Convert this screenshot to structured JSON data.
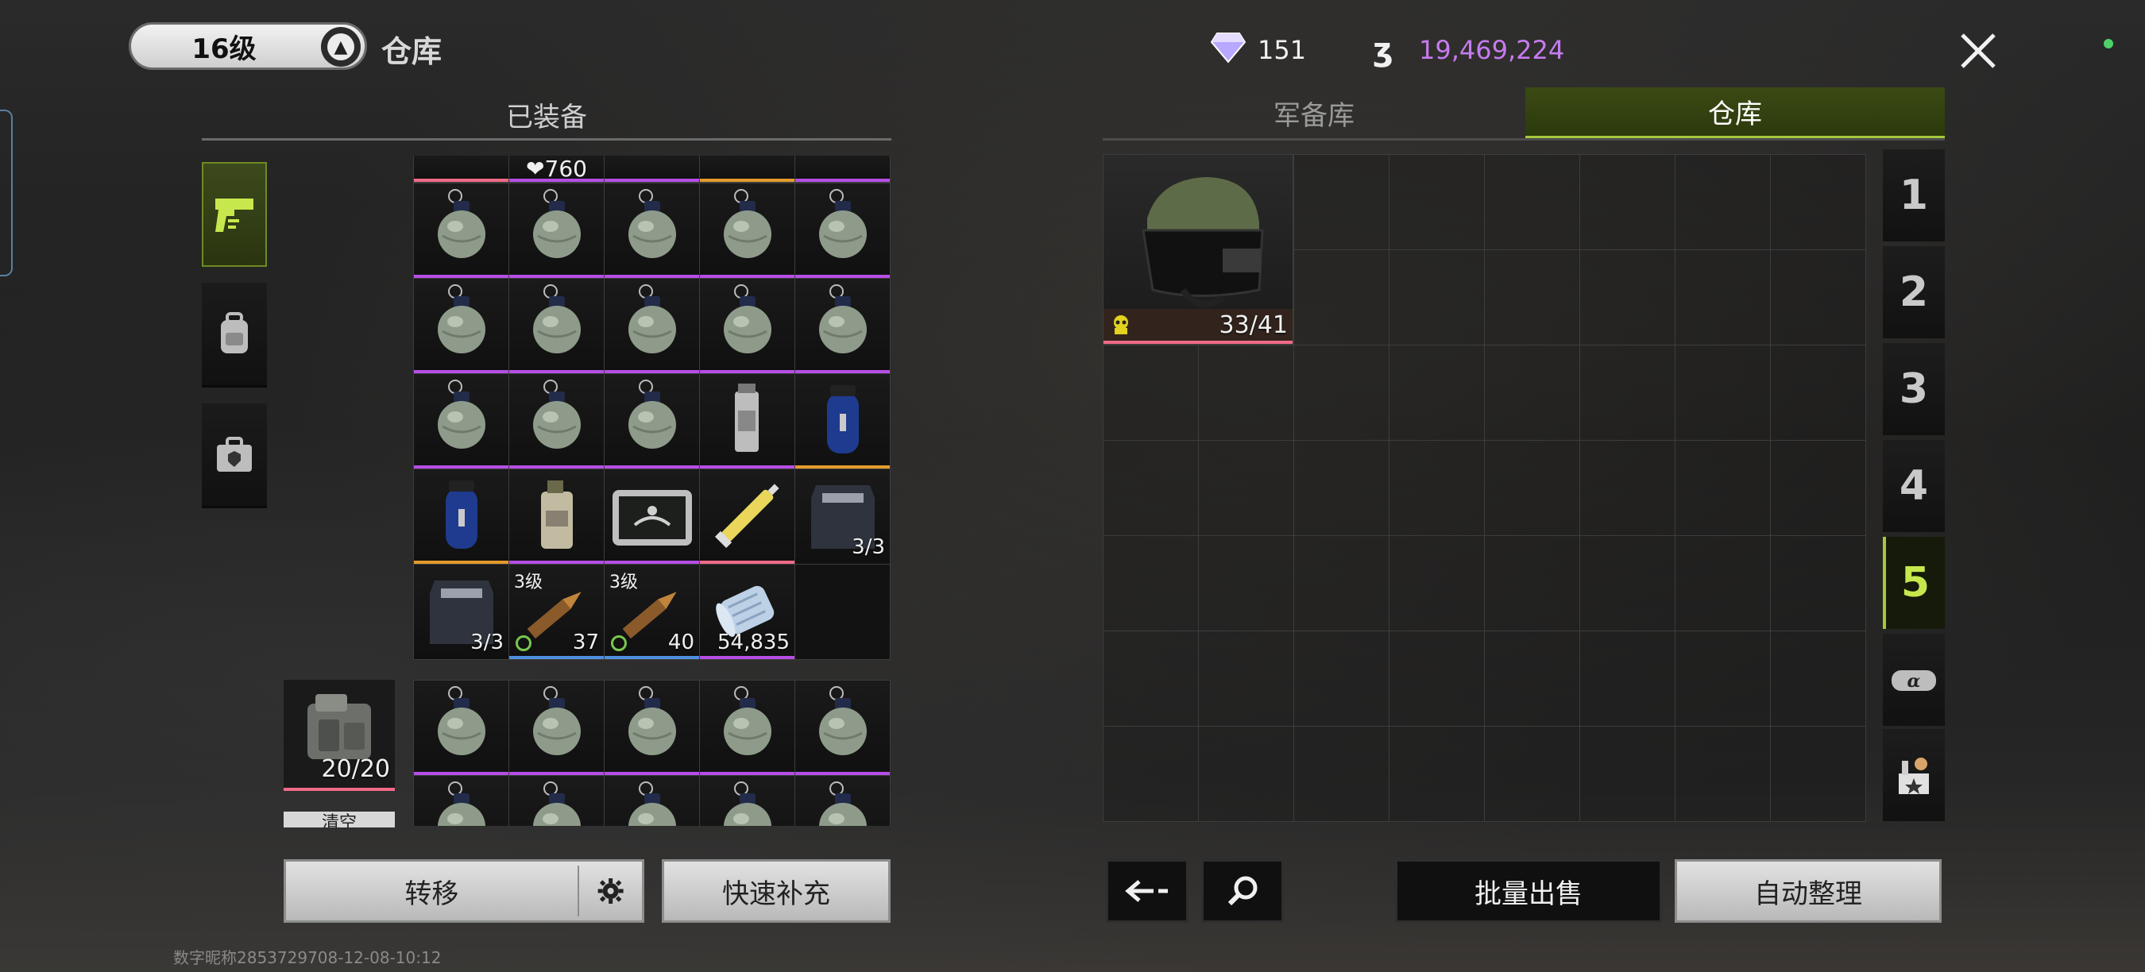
{
  "header": {
    "level": "16级",
    "title": "仓库",
    "diamonds": "151",
    "money": "19,469,224"
  },
  "colors": {
    "accent_green": "#a5c83a",
    "money_purple": "#c67bf0",
    "rarity_purple": "#b64ee6",
    "rarity_orange": "#e39b2d",
    "rarity_pink": "#f06a88"
  },
  "left": {
    "title": "已装备",
    "side_tabs": [
      "pistol-icon",
      "backpack-icon",
      "vest-icon"
    ],
    "top_partial": [
      "",
      "❤760",
      "",
      "",
      ""
    ],
    "grid": [
      [
        {
          "icon": "grenade-icon",
          "bar": "purple"
        },
        {
          "icon": "grenade-icon",
          "bar": "purple"
        },
        {
          "icon": "grenade-icon",
          "bar": "purple"
        },
        {
          "icon": "grenade-icon",
          "bar": "purple"
        },
        {
          "icon": "grenade-icon",
          "bar": "purple"
        }
      ],
      [
        {
          "icon": "grenade-icon",
          "bar": "purple"
        },
        {
          "icon": "grenade-icon",
          "bar": "purple"
        },
        {
          "icon": "grenade-icon",
          "bar": "purple"
        },
        {
          "icon": "grenade-icon",
          "bar": "purple"
        },
        {
          "icon": "grenade-icon",
          "bar": "purple"
        }
      ],
      [
        {
          "icon": "grenade-icon",
          "bar": "purple"
        },
        {
          "icon": "grenade-icon",
          "bar": "purple"
        },
        {
          "icon": "grenade-icon",
          "bar": "purple"
        },
        {
          "icon": "smoke-canister-icon",
          "bar": "purple"
        },
        {
          "icon": "blue-canister-icon",
          "bar": "orange"
        }
      ],
      [
        {
          "icon": "blue-canister-icon",
          "bar": "orange"
        },
        {
          "icon": "smoke-grenade-icon",
          "bar": "purple"
        },
        {
          "icon": "tablet-device-icon",
          "bar": "purple"
        },
        {
          "icon": "syringe-icon",
          "bar": "pink"
        },
        {
          "icon": "armor-plate-icon",
          "bar": "",
          "count": "3/3"
        }
      ],
      [
        {
          "icon": "armor-plate-icon",
          "bar": "",
          "count": "3/3"
        },
        {
          "icon": "bullet-icon",
          "bar": "blue",
          "tier": "3级",
          "count": "37"
        },
        {
          "icon": "bullet-icon",
          "bar": "blue",
          "tier": "3级",
          "count": "40"
        },
        {
          "icon": "bandage-icon",
          "bar": "purple",
          "count": "54,835"
        },
        {
          "icon": "",
          "bar": ""
        }
      ]
    ],
    "ammo_box_count": "20/20",
    "clear_label": "清空",
    "lower_grid_rows": 2,
    "transfer_label": "转移",
    "quick_refill_label": "快速补充",
    "footer_id": "数字昵称2853729708-12-08-10:12"
  },
  "right": {
    "tabs": [
      "军备库",
      "仓库"
    ],
    "helmet_durability": "33/41",
    "pages": [
      "1",
      "2",
      "3",
      "4",
      "5"
    ],
    "active_page": "5",
    "bulk_sell_label": "批量出售",
    "auto_sort_label": "自动整理"
  }
}
